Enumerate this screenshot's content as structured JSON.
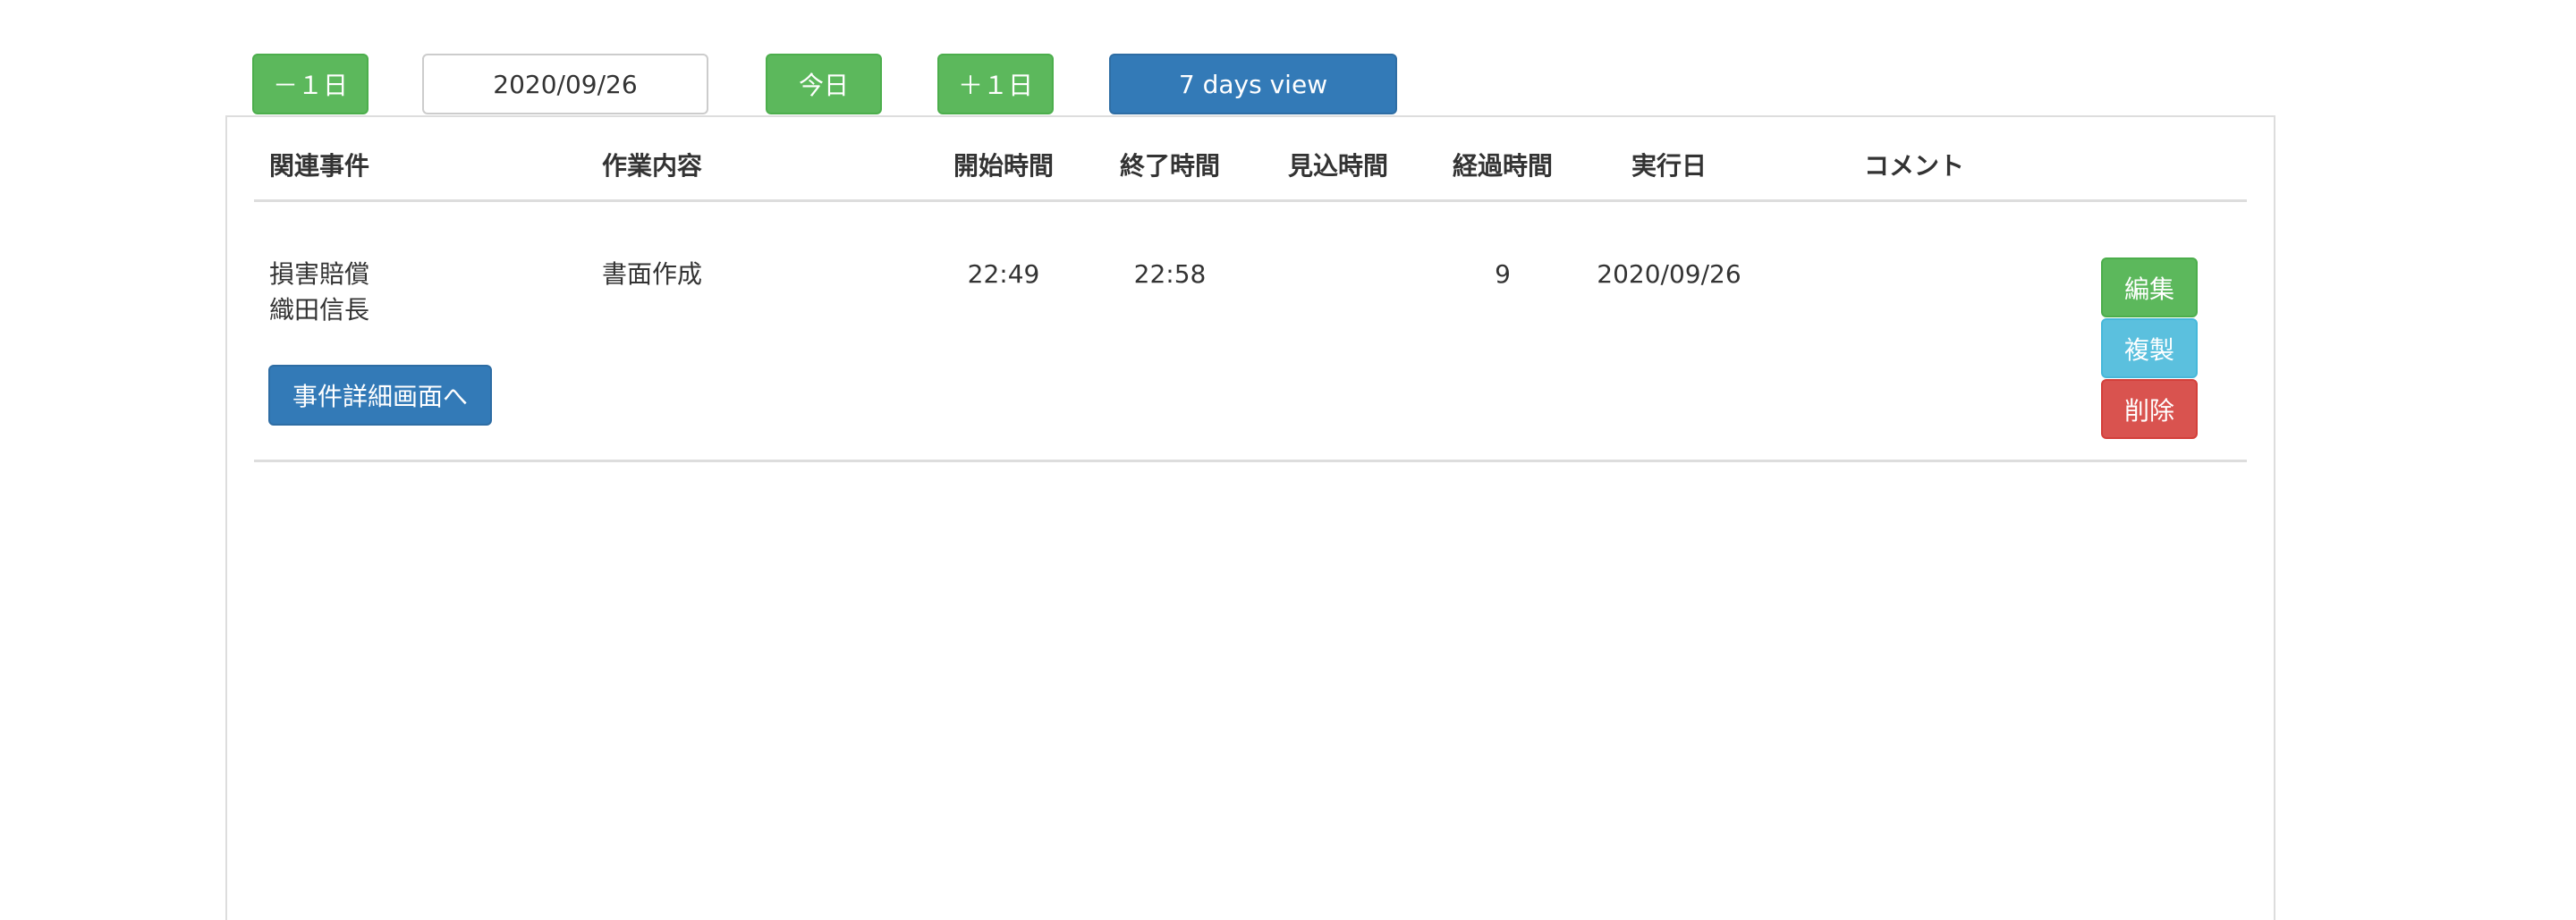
{
  "toolbar": {
    "prev_day_label": "－１日",
    "date_value": "2020/09/26",
    "today_label": "今日",
    "next_day_label": "＋１日",
    "seven_days_label": "7 days view"
  },
  "table": {
    "headers": {
      "related_case": "関連事件",
      "task": "作業内容",
      "start_time": "開始時間",
      "end_time": "終了時間",
      "estimated_time": "見込時間",
      "elapsed_time": "経過時間",
      "execution_date": "実行日",
      "comment": "コメント"
    },
    "rows": [
      {
        "case_name_line1": "損害賠償",
        "case_name_line2": "織田信長",
        "case_detail_button": "事件詳細画面へ",
        "task": "書面作成",
        "start_time": "22:49",
        "end_time": "22:58",
        "estimated_time": "",
        "elapsed_time": "9",
        "execution_date": "2020/09/26",
        "comment": "",
        "edit_label": "編集",
        "copy_label": "複製",
        "delete_label": "削除"
      }
    ]
  },
  "colors": {
    "success": "#5cb85c",
    "primary": "#337ab7",
    "info": "#5bc0de",
    "danger": "#d9534f"
  }
}
